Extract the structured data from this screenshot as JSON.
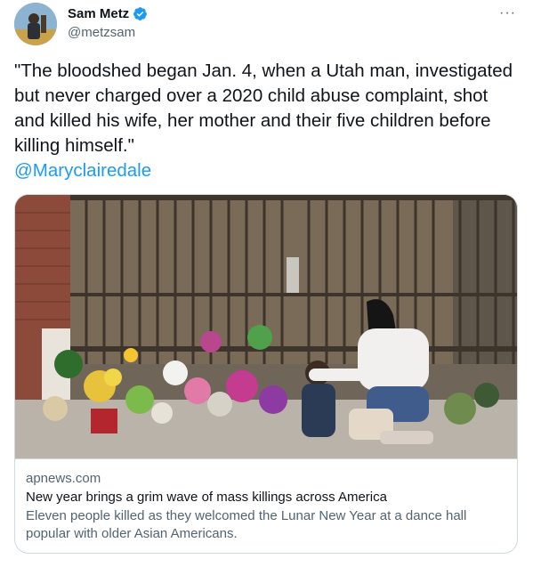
{
  "author": {
    "display_name": "Sam Metz",
    "handle": "@metzsam",
    "avatar_icon": "user-avatar-photo",
    "verified": true
  },
  "tweet": {
    "text": "\"The bloodshed began Jan. 4, when a Utah man, investigated but never charged over a 2020 child abuse complaint, shot and killed his wife, her mother and their five children before killing himself.\"",
    "mention": "@Maryclairedale"
  },
  "more_menu": {
    "icon": "more-horizontal-icon",
    "label": "···"
  },
  "link_card": {
    "domain": "apnews.com",
    "title": "New year brings a grim wave of mass killings across America",
    "description": "Eleven people killed as they welcomed the Lunar New Year at a dance hall popular with older Asian Americans."
  },
  "colors": {
    "link": "#1d9bf0",
    "secondary_text": "#536471",
    "primary_text": "#0f1419",
    "border": "#cfd9de"
  }
}
